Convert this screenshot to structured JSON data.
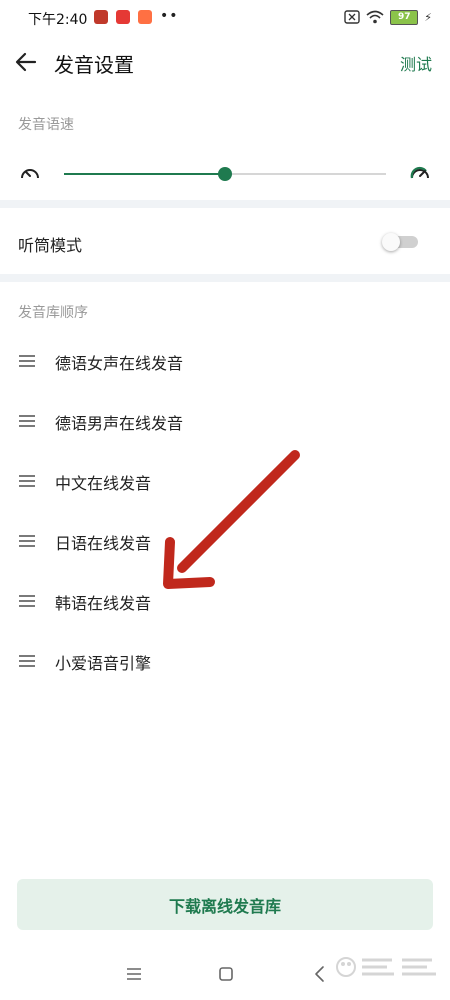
{
  "status_bar": {
    "time": "下午2:40",
    "battery": "97",
    "icons": [
      "app-icon-1",
      "app-icon-2",
      "app-icon-3",
      "sim-icon",
      "wifi-icon",
      "battery-icon",
      "charging-icon"
    ]
  },
  "header": {
    "title": "发音设置",
    "action_label": "测试"
  },
  "speed": {
    "label": "发音语速",
    "value_fraction": 0.5
  },
  "earpiece": {
    "label": "听筒模式",
    "enabled": false
  },
  "library_order": {
    "label": "发音库顺序",
    "items": [
      {
        "label": "德语女声在线发音"
      },
      {
        "label": "德语男声在线发音"
      },
      {
        "label": "中文在线发音"
      },
      {
        "label": "日语在线发音"
      },
      {
        "label": "韩语在线发音"
      },
      {
        "label": "小爱语音引擎"
      }
    ]
  },
  "download_button": {
    "label": "下载离线发音库"
  },
  "colors": {
    "accent": "#1f7a4f",
    "button_bg": "#e5f1ea",
    "annotation_arrow": "#c0281c"
  }
}
